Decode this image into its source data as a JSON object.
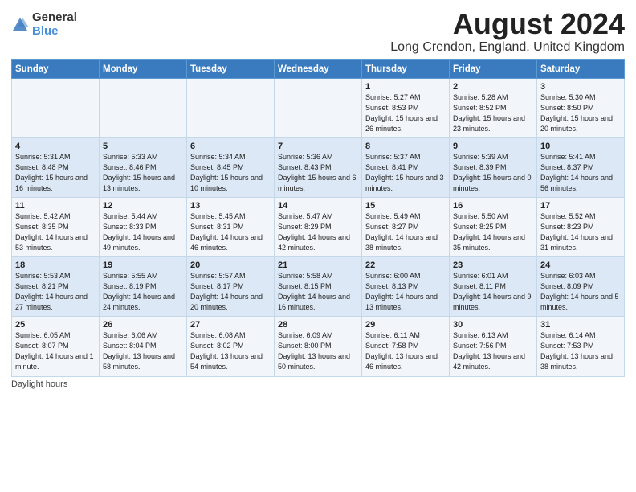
{
  "logo": {
    "general": "General",
    "blue": "Blue"
  },
  "title": "August 2024",
  "location": "Long Crendon, England, United Kingdom",
  "days_header": [
    "Sunday",
    "Monday",
    "Tuesday",
    "Wednesday",
    "Thursday",
    "Friday",
    "Saturday"
  ],
  "footer": "Daylight hours",
  "weeks": [
    [
      {
        "num": "",
        "info": ""
      },
      {
        "num": "",
        "info": ""
      },
      {
        "num": "",
        "info": ""
      },
      {
        "num": "",
        "info": ""
      },
      {
        "num": "1",
        "info": "Sunrise: 5:27 AM\nSunset: 8:53 PM\nDaylight: 15 hours and 26 minutes."
      },
      {
        "num": "2",
        "info": "Sunrise: 5:28 AM\nSunset: 8:52 PM\nDaylight: 15 hours and 23 minutes."
      },
      {
        "num": "3",
        "info": "Sunrise: 5:30 AM\nSunset: 8:50 PM\nDaylight: 15 hours and 20 minutes."
      }
    ],
    [
      {
        "num": "4",
        "info": "Sunrise: 5:31 AM\nSunset: 8:48 PM\nDaylight: 15 hours and 16 minutes."
      },
      {
        "num": "5",
        "info": "Sunrise: 5:33 AM\nSunset: 8:46 PM\nDaylight: 15 hours and 13 minutes."
      },
      {
        "num": "6",
        "info": "Sunrise: 5:34 AM\nSunset: 8:45 PM\nDaylight: 15 hours and 10 minutes."
      },
      {
        "num": "7",
        "info": "Sunrise: 5:36 AM\nSunset: 8:43 PM\nDaylight: 15 hours and 6 minutes."
      },
      {
        "num": "8",
        "info": "Sunrise: 5:37 AM\nSunset: 8:41 PM\nDaylight: 15 hours and 3 minutes."
      },
      {
        "num": "9",
        "info": "Sunrise: 5:39 AM\nSunset: 8:39 PM\nDaylight: 15 hours and 0 minutes."
      },
      {
        "num": "10",
        "info": "Sunrise: 5:41 AM\nSunset: 8:37 PM\nDaylight: 14 hours and 56 minutes."
      }
    ],
    [
      {
        "num": "11",
        "info": "Sunrise: 5:42 AM\nSunset: 8:35 PM\nDaylight: 14 hours and 53 minutes."
      },
      {
        "num": "12",
        "info": "Sunrise: 5:44 AM\nSunset: 8:33 PM\nDaylight: 14 hours and 49 minutes."
      },
      {
        "num": "13",
        "info": "Sunrise: 5:45 AM\nSunset: 8:31 PM\nDaylight: 14 hours and 46 minutes."
      },
      {
        "num": "14",
        "info": "Sunrise: 5:47 AM\nSunset: 8:29 PM\nDaylight: 14 hours and 42 minutes."
      },
      {
        "num": "15",
        "info": "Sunrise: 5:49 AM\nSunset: 8:27 PM\nDaylight: 14 hours and 38 minutes."
      },
      {
        "num": "16",
        "info": "Sunrise: 5:50 AM\nSunset: 8:25 PM\nDaylight: 14 hours and 35 minutes."
      },
      {
        "num": "17",
        "info": "Sunrise: 5:52 AM\nSunset: 8:23 PM\nDaylight: 14 hours and 31 minutes."
      }
    ],
    [
      {
        "num": "18",
        "info": "Sunrise: 5:53 AM\nSunset: 8:21 PM\nDaylight: 14 hours and 27 minutes."
      },
      {
        "num": "19",
        "info": "Sunrise: 5:55 AM\nSunset: 8:19 PM\nDaylight: 14 hours and 24 minutes."
      },
      {
        "num": "20",
        "info": "Sunrise: 5:57 AM\nSunset: 8:17 PM\nDaylight: 14 hours and 20 minutes."
      },
      {
        "num": "21",
        "info": "Sunrise: 5:58 AM\nSunset: 8:15 PM\nDaylight: 14 hours and 16 minutes."
      },
      {
        "num": "22",
        "info": "Sunrise: 6:00 AM\nSunset: 8:13 PM\nDaylight: 14 hours and 13 minutes."
      },
      {
        "num": "23",
        "info": "Sunrise: 6:01 AM\nSunset: 8:11 PM\nDaylight: 14 hours and 9 minutes."
      },
      {
        "num": "24",
        "info": "Sunrise: 6:03 AM\nSunset: 8:09 PM\nDaylight: 14 hours and 5 minutes."
      }
    ],
    [
      {
        "num": "25",
        "info": "Sunrise: 6:05 AM\nSunset: 8:07 PM\nDaylight: 14 hours and 1 minute."
      },
      {
        "num": "26",
        "info": "Sunrise: 6:06 AM\nSunset: 8:04 PM\nDaylight: 13 hours and 58 minutes."
      },
      {
        "num": "27",
        "info": "Sunrise: 6:08 AM\nSunset: 8:02 PM\nDaylight: 13 hours and 54 minutes."
      },
      {
        "num": "28",
        "info": "Sunrise: 6:09 AM\nSunset: 8:00 PM\nDaylight: 13 hours and 50 minutes."
      },
      {
        "num": "29",
        "info": "Sunrise: 6:11 AM\nSunset: 7:58 PM\nDaylight: 13 hours and 46 minutes."
      },
      {
        "num": "30",
        "info": "Sunrise: 6:13 AM\nSunset: 7:56 PM\nDaylight: 13 hours and 42 minutes."
      },
      {
        "num": "31",
        "info": "Sunrise: 6:14 AM\nSunset: 7:53 PM\nDaylight: 13 hours and 38 minutes."
      }
    ]
  ]
}
